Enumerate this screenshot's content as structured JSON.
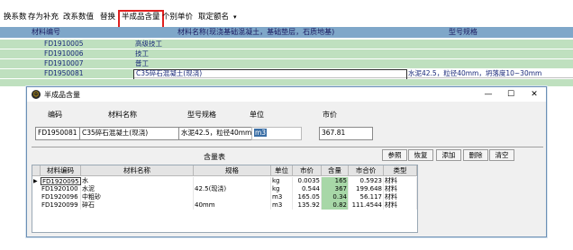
{
  "toolbar": {
    "items": [
      "换系数",
      "存为补充",
      "改系数值",
      "替换",
      "半成品含量",
      "个别单价",
      "取定额名"
    ],
    "dropdown_glyph": "▾"
  },
  "background": {
    "header": {
      "code": "材料编号",
      "name": "材料名称(现浇基础混凝土，基础垫层，石质地基)",
      "spec": "型号规格"
    },
    "rows": [
      {
        "code": "FD1910005",
        "name": "高级技工",
        "spec": ""
      },
      {
        "code": "FD1910006",
        "name": "技工",
        "spec": ""
      },
      {
        "code": "FD1910007",
        "name": "普工",
        "spec": ""
      },
      {
        "code": "FD1950081",
        "name": "C35碎石混凝土(现浇)",
        "spec": "水泥42.5，粒径40mm，坍落度10~30mm"
      }
    ]
  },
  "dialog": {
    "title": "半成品含量",
    "icon_glyph": "☺",
    "controls": {
      "minimize": "—",
      "maximize": "☐",
      "close": "✕"
    },
    "labels": {
      "code": "编码",
      "name": "材料名称",
      "spec": "型号规格",
      "unit": "单位",
      "price": "市价"
    },
    "fields": {
      "code": "FD1950081",
      "name": "C35碎石混凝土(现浇)",
      "spec": "水泥42.5，粒径40mm，",
      "unit": "m3",
      "price": "367.81"
    },
    "section_label": "含量表",
    "buttons": [
      "参照",
      "恢复",
      "添加",
      "删除",
      "清空"
    ],
    "table": {
      "headers": [
        "材料编码",
        "材料名称",
        "规格",
        "单位",
        "市价",
        "含量",
        "市合价",
        "类型"
      ],
      "row_marker": "▶",
      "rows": [
        {
          "code": "FD1920095",
          "name": "水",
          "spec": "",
          "unit": "kg",
          "price": "0.0035",
          "qty": "165",
          "total": "0.5923",
          "type": "材料"
        },
        {
          "code": "FD1920100",
          "name": "水泥",
          "spec": "42.5(现浇)",
          "unit": "kg",
          "price": "0.544",
          "qty": "367",
          "total": "199.648",
          "type": "材料"
        },
        {
          "code": "FD1920096",
          "name": "中粗砂",
          "spec": "",
          "unit": "m3",
          "price": "165.05",
          "qty": "0.34",
          "total": "56.117",
          "type": "材料"
        },
        {
          "code": "FD1920099",
          "name": "碎石",
          "spec": "40mm",
          "unit": "m3",
          "price": "135.92",
          "qty": "0.82",
          "total": "111.4544",
          "type": "材料"
        }
      ]
    }
  },
  "colors": {
    "header_blue": "#7fa7c9",
    "row_green": "#bfe0bf",
    "highlight_border": "#e02020",
    "qty_green": "#a7d7a7"
  }
}
